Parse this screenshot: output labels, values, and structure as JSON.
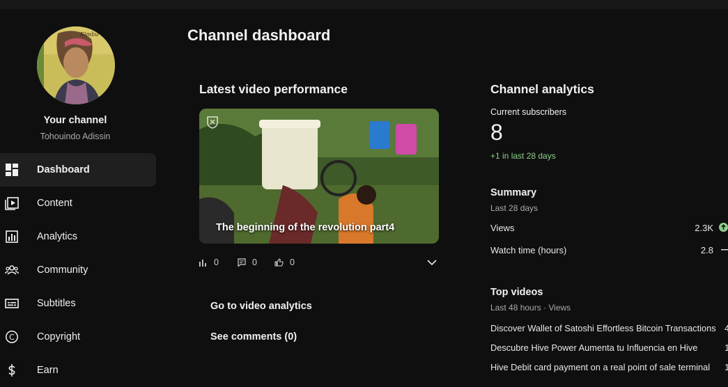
{
  "colors": {
    "background": "#0f0f0f",
    "active_nav": "#1f1f1f",
    "positive": "#8fce8f"
  },
  "sidebar": {
    "channel_label": "Your channel",
    "channel_handle": "Tohouindo Adissin",
    "items": [
      {
        "label": "Dashboard",
        "icon": "dashboard-icon",
        "active": true
      },
      {
        "label": "Content",
        "icon": "content-icon"
      },
      {
        "label": "Analytics",
        "icon": "analytics-icon"
      },
      {
        "label": "Community",
        "icon": "community-icon"
      },
      {
        "label": "Subtitles",
        "icon": "subtitles-icon"
      },
      {
        "label": "Copyright",
        "icon": "copyright-icon"
      },
      {
        "label": "Earn",
        "icon": "earn-icon"
      }
    ]
  },
  "main": {
    "page_title": "Channel dashboard",
    "latest_video": {
      "heading": "Latest video performance",
      "title": "The beginning of the revolution part4",
      "views": "0",
      "comments": "0",
      "likes": "0",
      "go_to_analytics": "Go to video analytics",
      "see_comments": "See comments (0)"
    },
    "channel_analytics": {
      "heading": "Channel analytics",
      "subscribers_label": "Current subscribers",
      "subscribers_value": "8",
      "subscribers_change": "+1 in last 28 days",
      "summary_title": "Summary",
      "summary_period": "Last 28 days",
      "summary_rows": [
        {
          "label": "Views",
          "value": "2.3K",
          "trend": "up"
        },
        {
          "label": "Watch time (hours)",
          "value": "2.8",
          "trend": "flat"
        }
      ],
      "top_videos_title": "Top videos",
      "top_videos_period": "Last 48 hours · Views",
      "top_videos": [
        {
          "title": "Discover Wallet of Satoshi Effortless Bitcoin Transactions",
          "count": "4"
        },
        {
          "title": "Descubre Hive Power Aumenta tu Influencia en Hive",
          "count": "1"
        },
        {
          "title": "Hive Debit card payment on a real point of sale terminal",
          "count": "1"
        }
      ]
    }
  }
}
